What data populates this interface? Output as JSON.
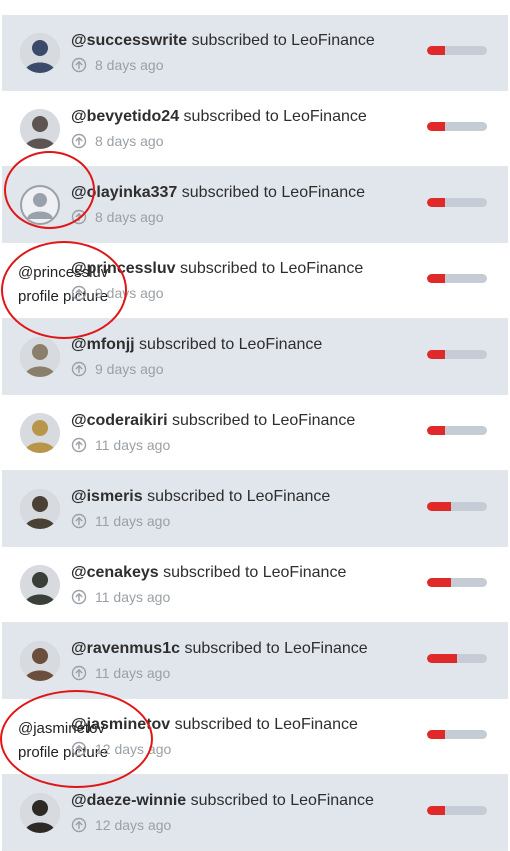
{
  "accent_color": "#e02a2a",
  "items": [
    {
      "username": "@successwrite",
      "action": "subscribed to LeoFinance",
      "time": "8 days ago",
      "vote_fraction": 0.3,
      "avatar": "photo",
      "alt_text": null
    },
    {
      "username": "@bevyetido24",
      "action": "subscribed to LeoFinance",
      "time": "8 days ago",
      "vote_fraction": 0.3,
      "avatar": "photo",
      "alt_text": null
    },
    {
      "username": "@olayinka337",
      "action": "subscribed to LeoFinance",
      "time": "8 days ago",
      "vote_fraction": 0.3,
      "avatar": "default-user-icon",
      "alt_text": null
    },
    {
      "username": "@princessluv",
      "action": "subscribed to LeoFinance",
      "time": "9 days ago",
      "vote_fraction": 0.3,
      "avatar": "broken-image",
      "alt_text": "@princessluv profile picture"
    },
    {
      "username": "@mfonjj",
      "action": "subscribed to LeoFinance",
      "time": "9 days ago",
      "vote_fraction": 0.3,
      "avatar": "photo",
      "alt_text": null
    },
    {
      "username": "@coderaikiri",
      "action": "subscribed to LeoFinance",
      "time": "11 days ago",
      "vote_fraction": 0.3,
      "avatar": "photo",
      "alt_text": null
    },
    {
      "username": "@ismeris",
      "action": "subscribed to LeoFinance",
      "time": "11 days ago",
      "vote_fraction": 0.4,
      "avatar": "photo",
      "alt_text": null
    },
    {
      "username": "@cenakeys",
      "action": "subscribed to LeoFinance",
      "time": "11 days ago",
      "vote_fraction": 0.4,
      "avatar": "photo",
      "alt_text": null
    },
    {
      "username": "@ravenmus1c",
      "action": "subscribed to LeoFinance",
      "time": "11 days ago",
      "vote_fraction": 0.5,
      "avatar": "photo",
      "alt_text": null
    },
    {
      "username": "@jasminetov",
      "action": "subscribed to LeoFinance",
      "time": "12 days ago",
      "vote_fraction": 0.3,
      "avatar": "broken-image",
      "alt_text": "@jasminetov profile picture"
    },
    {
      "username": "@daeze-winnie",
      "action": "subscribed to LeoFinance",
      "time": "12 days ago",
      "vote_fraction": 0.3,
      "avatar": "photo",
      "alt_text": null
    }
  ]
}
